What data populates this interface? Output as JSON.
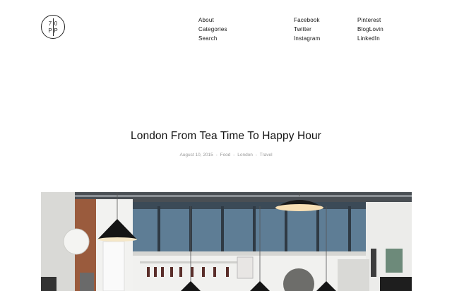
{
  "logo": {
    "chars": [
      "7",
      "0",
      "P",
      "P"
    ]
  },
  "nav": {
    "col1": [
      "About",
      "Categories",
      "Search"
    ],
    "col2": [
      "Facebook",
      "Twitter",
      "Instagram"
    ],
    "col3": [
      "Pinterest",
      "BlogLovin",
      "LinkedIn"
    ]
  },
  "post": {
    "title": "London From Tea Time To Happy Hour",
    "date": "August 10, 2015",
    "categories": [
      "Food",
      "London",
      "Travel"
    ],
    "separator": "-"
  },
  "colors": {
    "text": "#111111",
    "meta": "#999999",
    "background": "#ffffff"
  }
}
